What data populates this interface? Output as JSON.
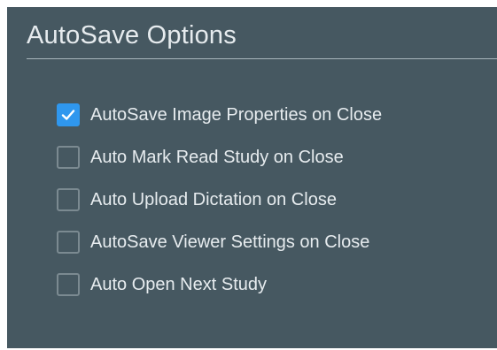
{
  "panel": {
    "title": "AutoSave Options"
  },
  "options": [
    {
      "label": "AutoSave Image Properties on Close",
      "checked": true
    },
    {
      "label": "Auto Mark Read Study on Close",
      "checked": false
    },
    {
      "label": "Auto Upload Dictation on Close",
      "checked": false
    },
    {
      "label": "AutoSave Viewer Settings on Close",
      "checked": false
    },
    {
      "label": "Auto Open Next Study",
      "checked": false
    }
  ],
  "colors": {
    "panel_background": "#465861",
    "checked_accent": "#2f97ee",
    "text": "#e7ecef"
  },
  "icons": {
    "checked": "checkmark-icon"
  }
}
